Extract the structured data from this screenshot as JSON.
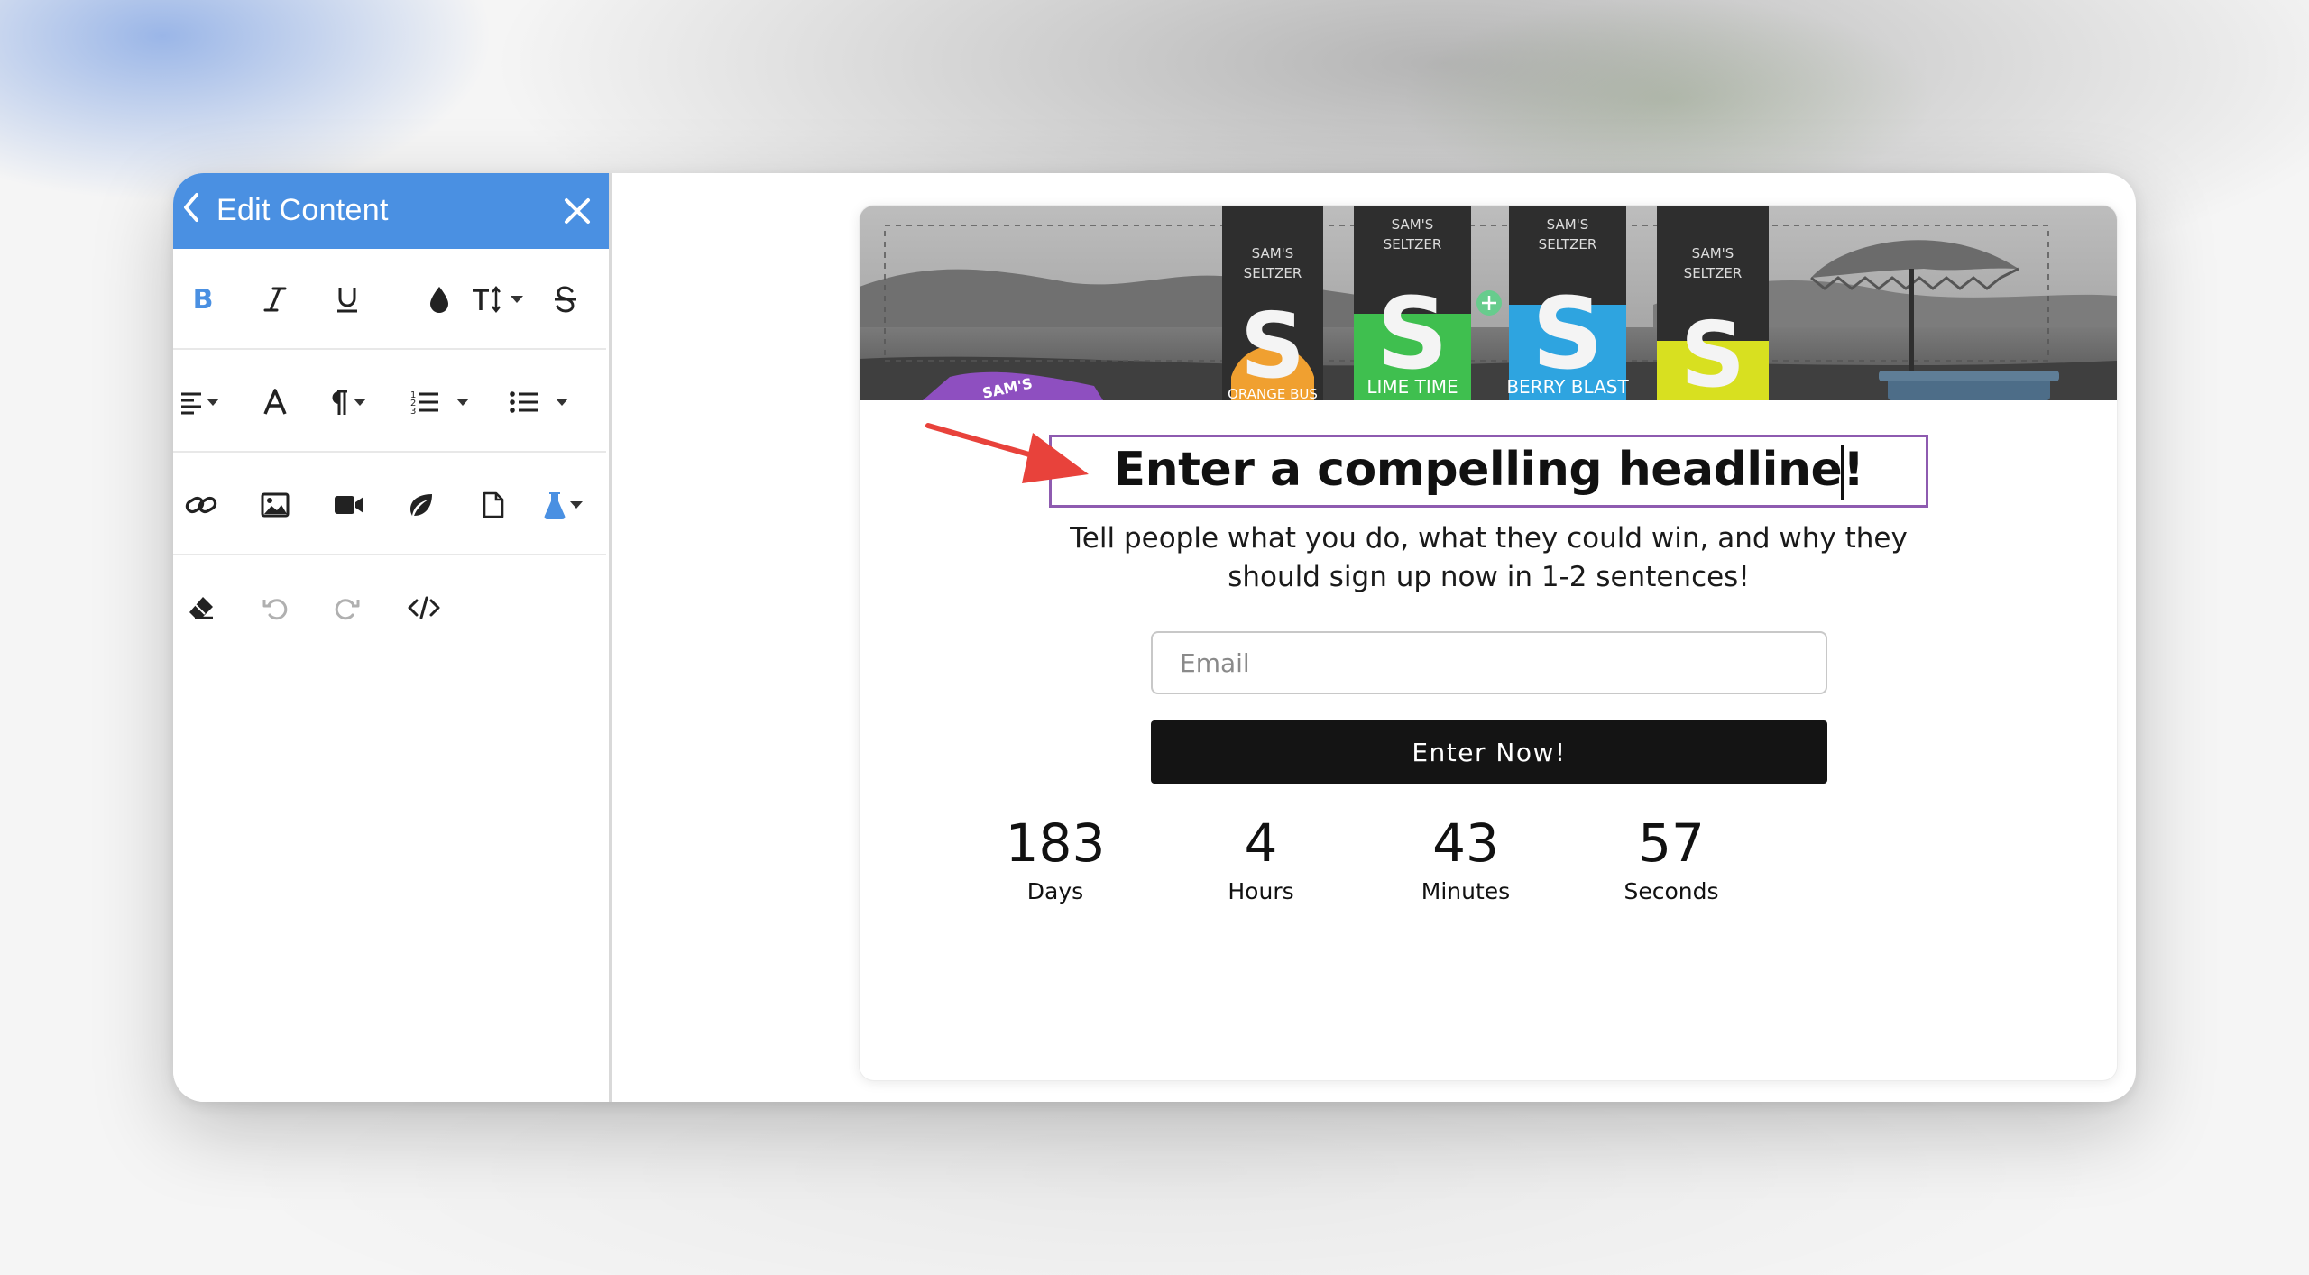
{
  "sidebar": {
    "title": "Edit Content",
    "icons": {
      "back": "chevron-left-icon",
      "close": "close-icon",
      "row1": [
        "bold-icon",
        "italic-icon",
        "underline-icon",
        "text-color-drop-icon",
        "font-size-icon",
        "strikethrough-icon"
      ],
      "row2": [
        "align-icon",
        "font-family-icon",
        "paragraph-format-icon",
        "ordered-list-icon",
        "unordered-list-icon"
      ],
      "row3": [
        "link-icon",
        "image-icon",
        "video-icon",
        "leaf-icon",
        "file-icon",
        "flask-icon"
      ],
      "row4": [
        "eraser-icon",
        "undo-icon",
        "redo-icon",
        "code-view-icon"
      ]
    }
  },
  "preview": {
    "banner": {
      "can_labels": [
        "ORANGE BUS",
        "LIME TIME",
        "BERRY BLAST",
        ""
      ],
      "can_brand": "SAM'S SELTZER",
      "can_colors": [
        "#f0a030",
        "#3fbf4f",
        "#2ea4e0",
        "#d8e020"
      ]
    },
    "headline": "Enter a compelling headline",
    "headline_end": "!",
    "subtext": "Tell people what you do, what they could win, and why they should sign up now in 1-2 sentences!",
    "email_placeholder": "Email",
    "email_value": "",
    "cta_label": "Enter Now!",
    "countdown": [
      {
        "value": "183",
        "label": "Days"
      },
      {
        "value": "4",
        "label": "Hours"
      },
      {
        "value": "43",
        "label": "Minutes"
      },
      {
        "value": "57",
        "label": "Seconds"
      }
    ]
  },
  "colors": {
    "accent": "#4a90e2",
    "selection_border": "#8e5bb0",
    "cta_background": "#141414",
    "annotation_arrow": "#e8423b"
  }
}
